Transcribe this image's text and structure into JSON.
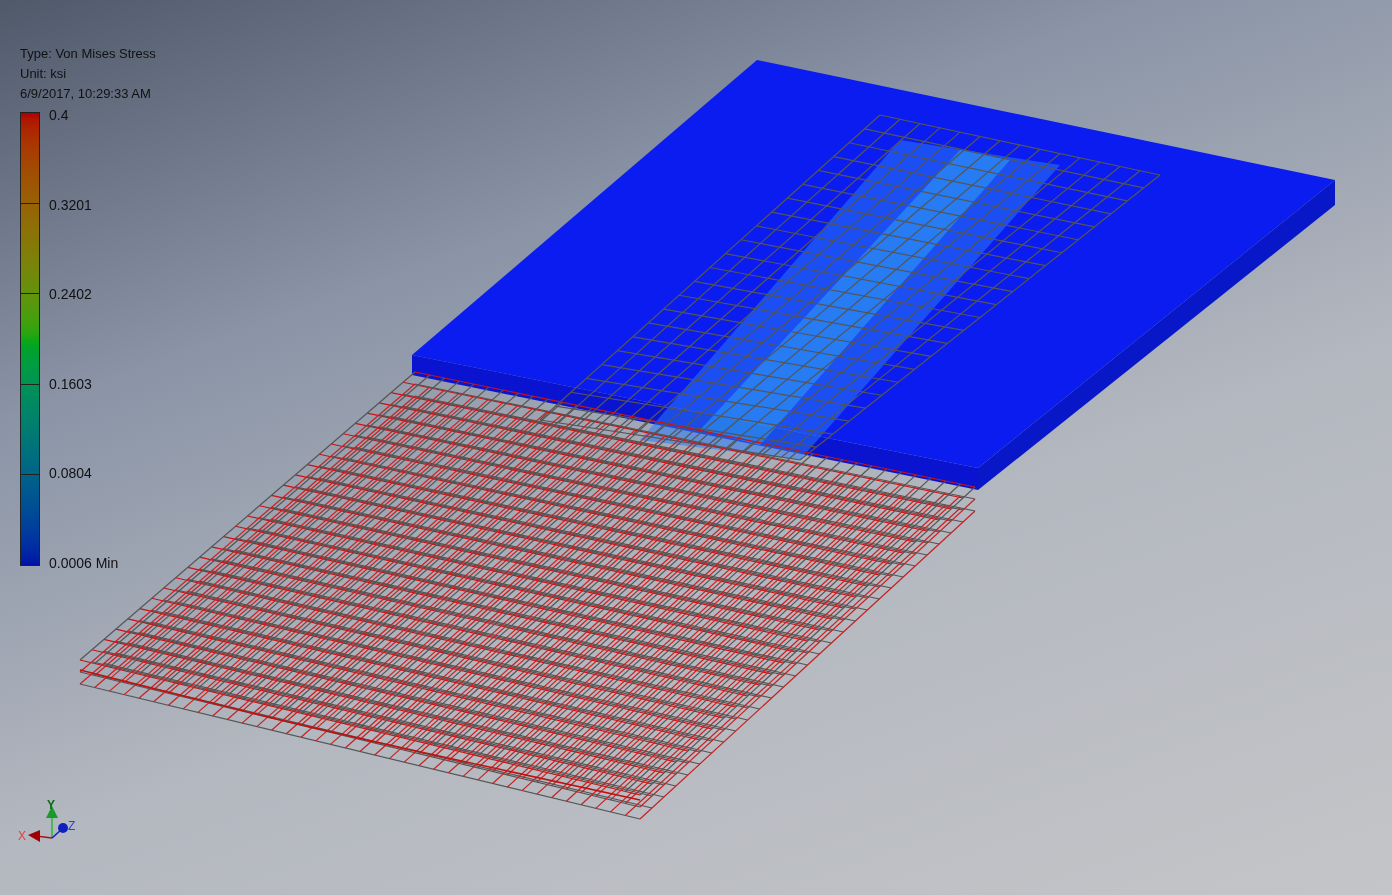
{
  "legend": {
    "type": "Type: Von Mises Stress",
    "unit": "Unit: ksi",
    "timestamp": "6/9/2017, 10:29:33 AM",
    "ticks": [
      "0.4",
      "0.3201",
      "0.2402",
      "0.1603",
      "0.0804",
      "0.0006 Min"
    ]
  },
  "triad": {
    "x": "X",
    "y": "Y",
    "z": "Z"
  }
}
